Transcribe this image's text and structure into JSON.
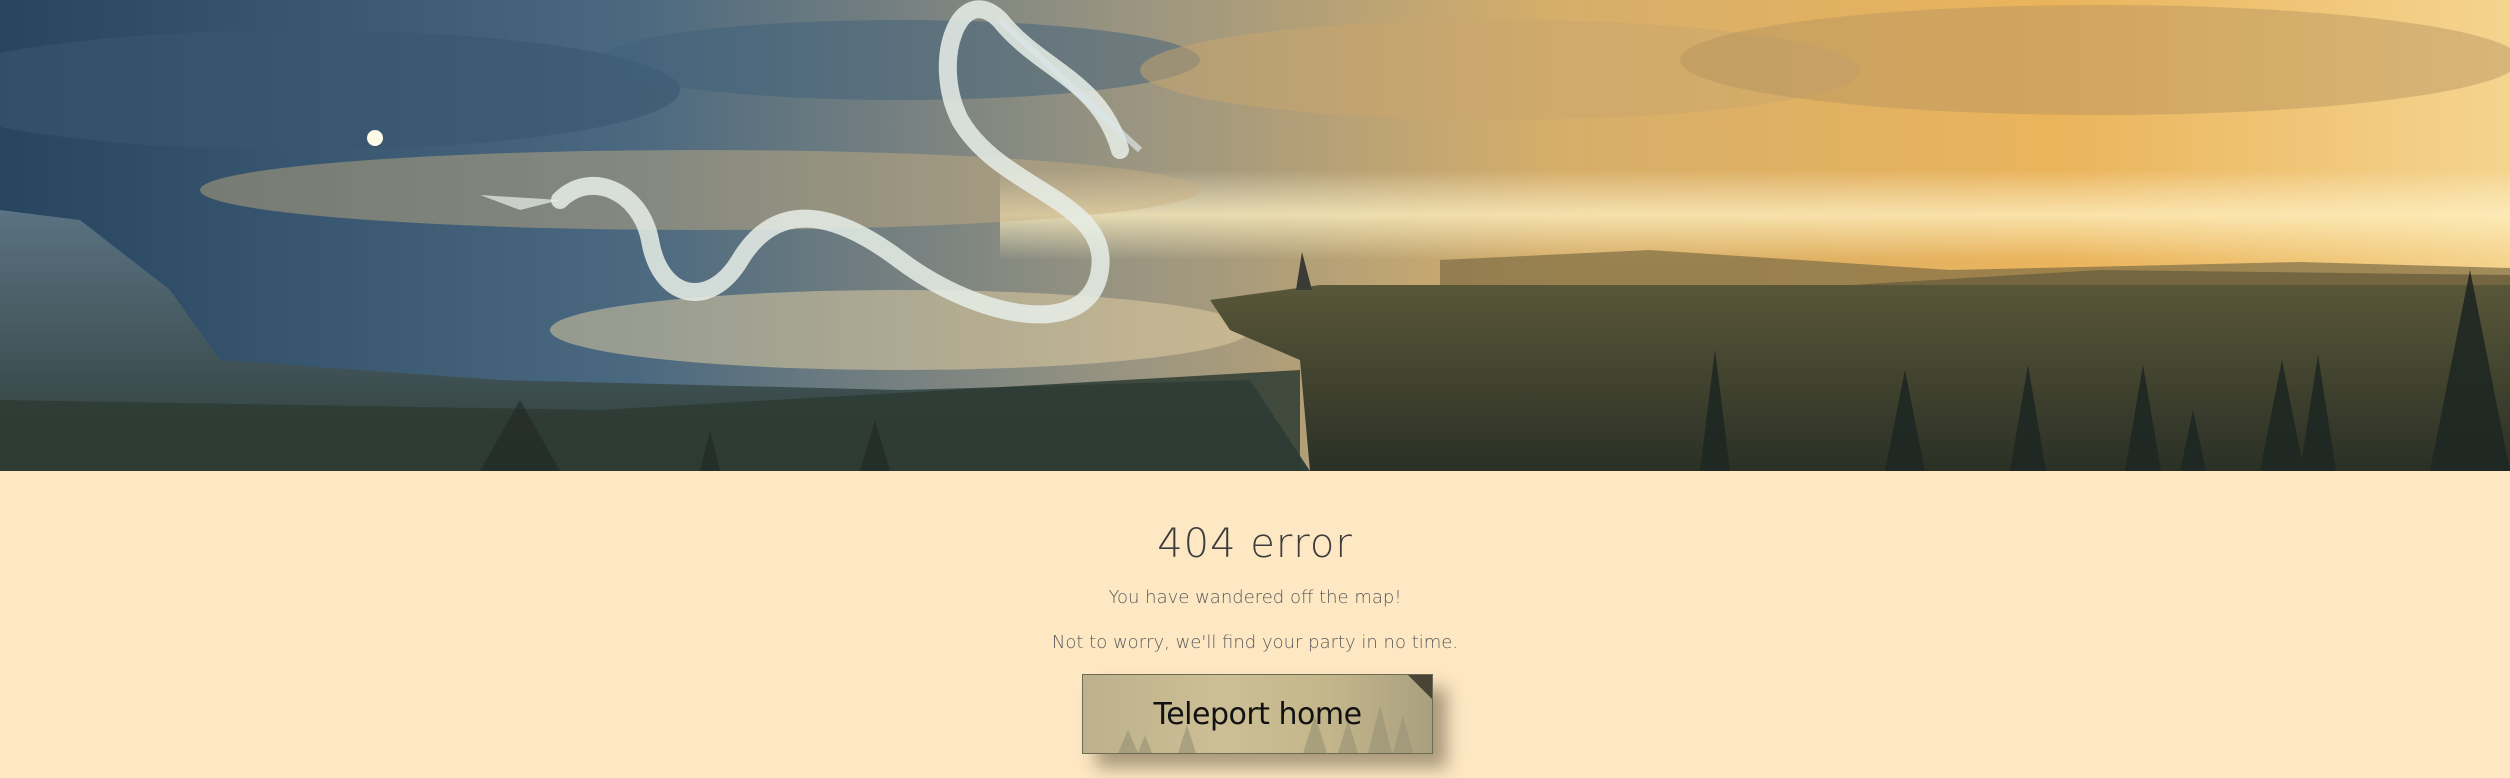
{
  "hero": {
    "image_name": "dragon-sky-landscape"
  },
  "error": {
    "title": "404 error",
    "message_line1": "You have wandered off the map!",
    "message_line2": "Not to worry, we'll find your party in no time."
  },
  "actions": {
    "home_button_label": "Teleport home"
  },
  "colors": {
    "page_background": "#fde8c3",
    "text": "#4a4a4a"
  }
}
